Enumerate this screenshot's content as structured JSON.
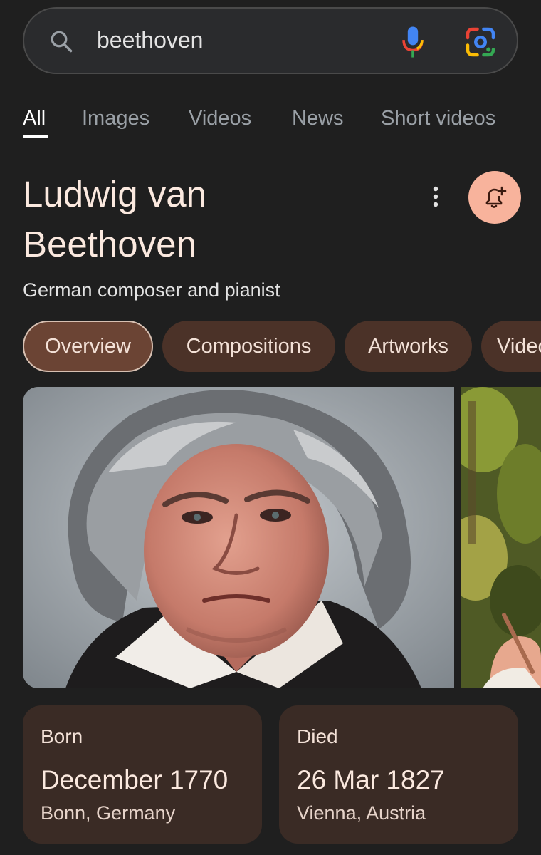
{
  "search": {
    "query": "beethoven",
    "icons": {
      "search": "search-icon",
      "mic": "mic-icon",
      "lens": "google-lens-icon"
    }
  },
  "tabs": [
    {
      "label": "All",
      "active": true
    },
    {
      "label": "Images"
    },
    {
      "label": "Videos"
    },
    {
      "label": "News"
    },
    {
      "label": "Short videos"
    }
  ],
  "entity": {
    "title_line1": "Ludwig van",
    "title_line2": "Beethoven",
    "subtitle": "German composer and pianist",
    "icons": {
      "menu": "more-vert-icon",
      "follow": "bell-plus-icon"
    }
  },
  "chips": [
    {
      "label": "Overview",
      "active": true
    },
    {
      "label": "Compositions"
    },
    {
      "label": "Artworks"
    },
    {
      "label": "Videos"
    }
  ],
  "facts": [
    {
      "label": "Born",
      "value": "December 1770",
      "place": "Bonn, Germany"
    },
    {
      "label": "Died",
      "value": "26 Mar 1827",
      "place": "Vienna, Austria"
    }
  ],
  "colors": {
    "background": "#1f1f1f",
    "chip_bg": "#4b3228",
    "chip_active_bg": "#6b4434",
    "follow_button": "#f8b39c",
    "fact_card_bg": "#3a2b25"
  }
}
